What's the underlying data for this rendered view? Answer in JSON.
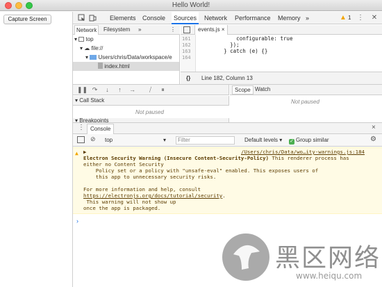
{
  "window": {
    "title": "Hello World!"
  },
  "app": {
    "capture_button": "Capture Screen"
  },
  "devtools": {
    "tabs": [
      "Elements",
      "Console",
      "Sources",
      "Network",
      "Performance",
      "Memory"
    ],
    "active_tab": "Sources",
    "more": "»",
    "warning_count": "1"
  },
  "navigator": {
    "tabs": [
      "Network",
      "Filesystem"
    ],
    "more": "»",
    "tree": [
      {
        "label": "top",
        "icon": "frame-icon"
      },
      {
        "label": "file://",
        "icon": "cloud-icon"
      },
      {
        "label": "Users/chris/Data/workspace/e",
        "icon": "folder-icon"
      },
      {
        "label": "index.html",
        "icon": "file-icon"
      }
    ]
  },
  "editor": {
    "file_tab": "events.js",
    "file_tab_close": "×",
    "lines": [
      {
        "n": "161",
        "code": "            configurable: true"
      },
      {
        "n": "162",
        "code": "          });"
      },
      {
        "n": "163",
        "code": "        } catch (e) {}"
      },
      {
        "n": "164",
        "code": ""
      }
    ],
    "status_braces": "{}",
    "status_position": "Line 182, Column 13"
  },
  "debugger": {
    "call_stack": "Call Stack",
    "breakpoints": "Breakpoints",
    "not_paused": "Not paused",
    "scope": "Scope",
    "watch": "Watch"
  },
  "console": {
    "tab_label": "Console",
    "close": "×",
    "context": "top",
    "filter_placeholder": "Filter",
    "levels": "Default levels ▾",
    "group_similar": "Group similar",
    "warning": {
      "source": "/Users/chris/Data/wo…ity-warnings.js:184",
      "title": "Electron Security Warning (Insecure Content-Security-Policy)",
      "title_rest": " This renderer process has",
      "line2": "either no Content Security",
      "line3": "    Policy set or a policy with \"unsafe-eval\" enabled. This exposes users of",
      "line4": "    this app to unnecessary security risks.",
      "line5": "For more information and help, consult",
      "link": "https://electronjs.org/docs/tutorial/security",
      "link_suffix": ".",
      "line7": " This warning will not show up",
      "line8": "once the app is packaged."
    },
    "prompt": "›"
  },
  "watermark": {
    "brand": "黑区网络",
    "url": "www.heiqu.com"
  }
}
